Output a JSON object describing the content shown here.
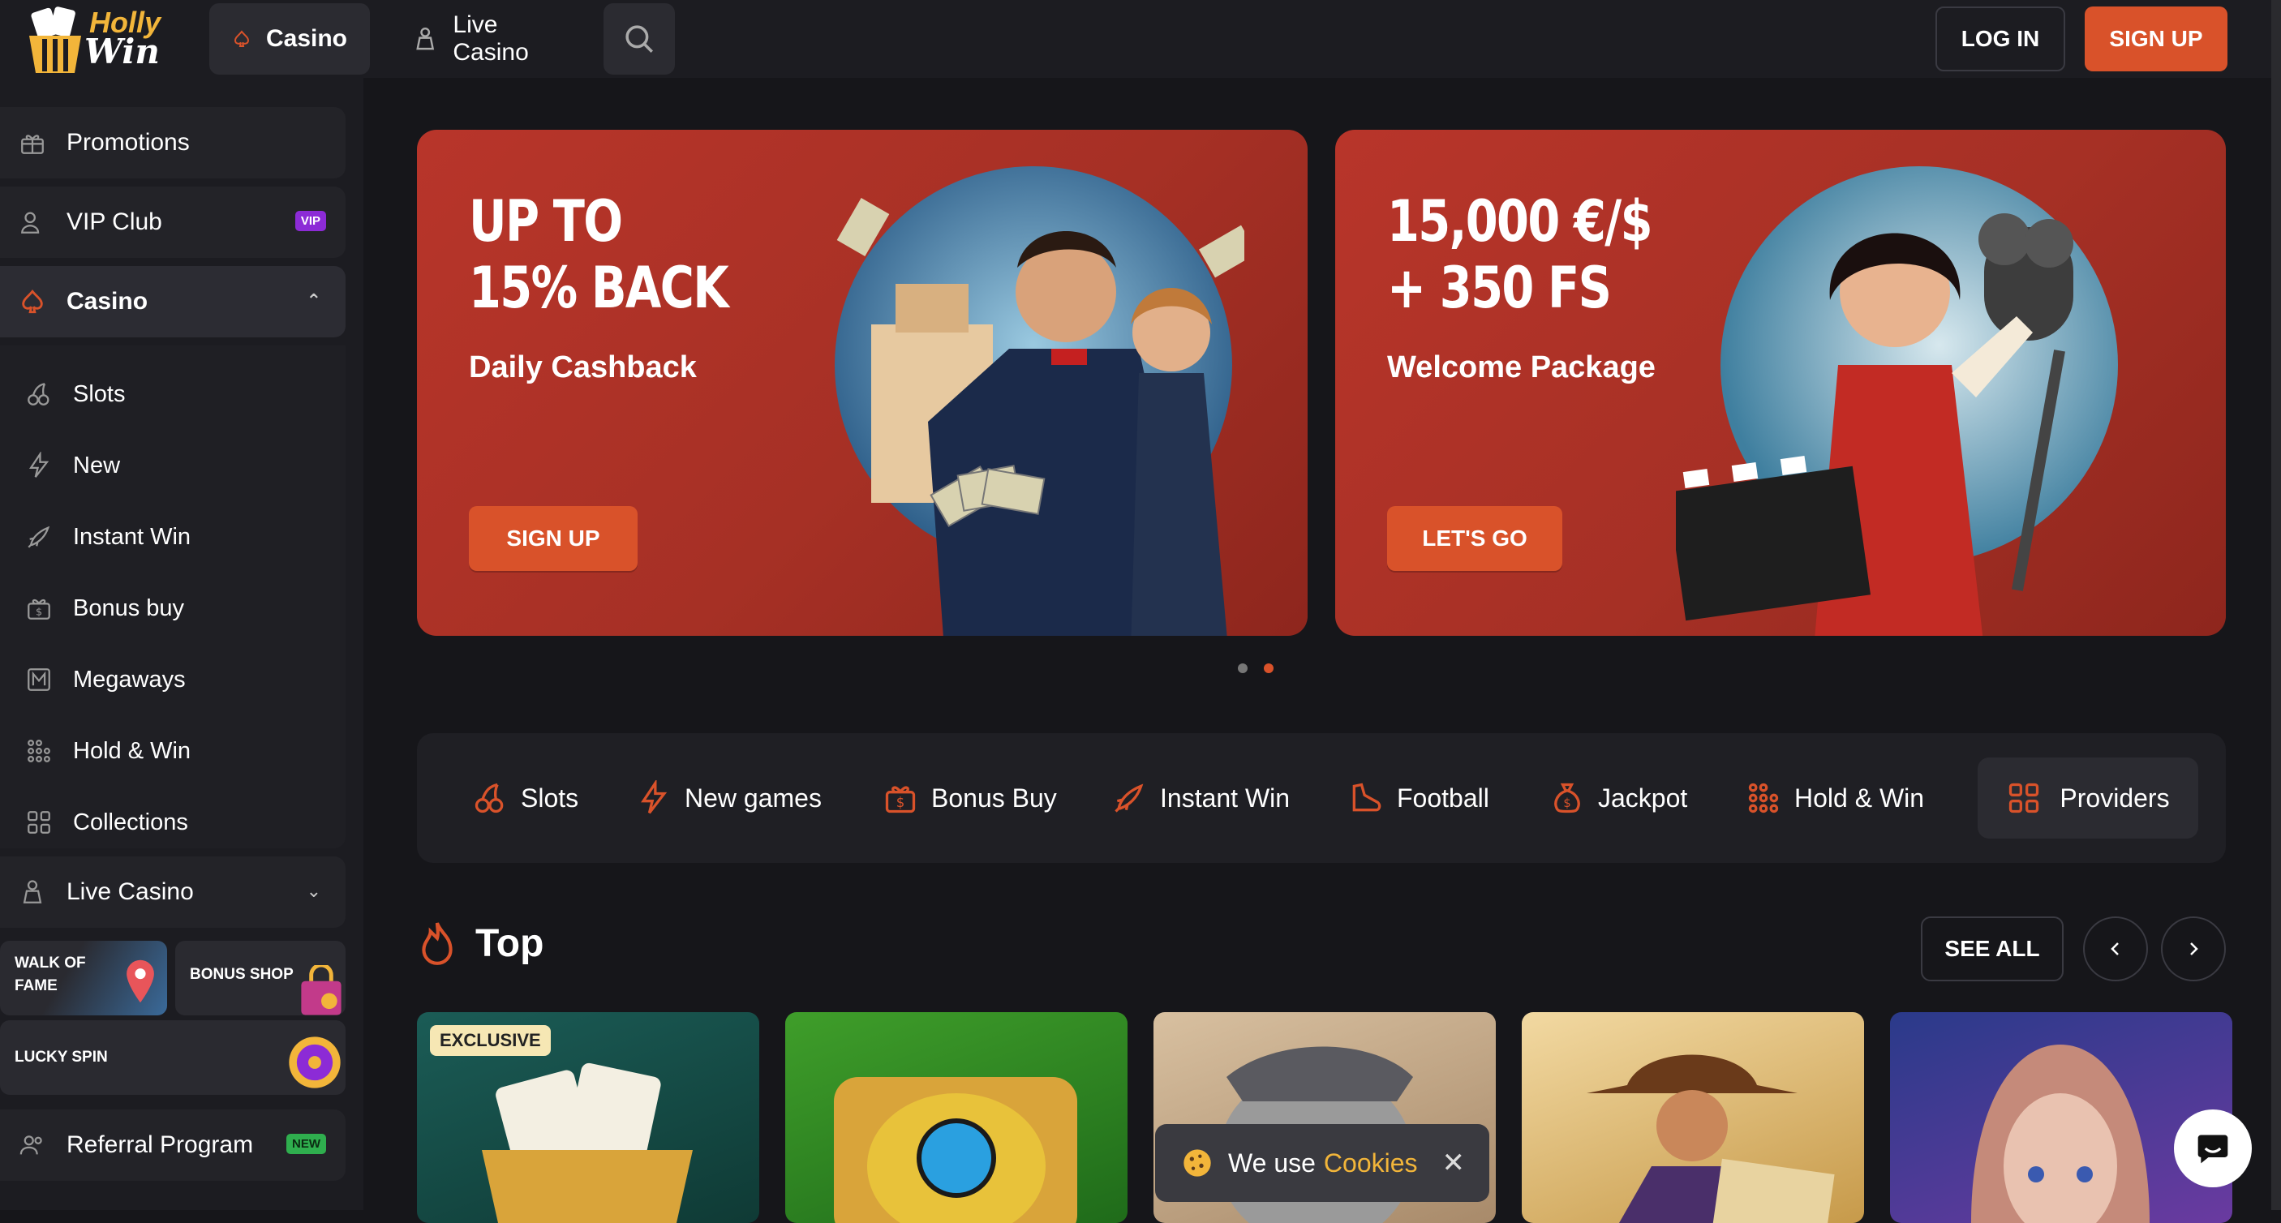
{
  "brand": {
    "name_line1": "Holly",
    "name_line2": "Win"
  },
  "header": {
    "nav": [
      {
        "label": "Casino"
      },
      {
        "label": "Live Casino"
      }
    ],
    "login_label": "LOG IN",
    "signup_label": "SIGN UP"
  },
  "sidebar": {
    "promotions": "Promotions",
    "vip": {
      "label": "VIP Club",
      "badge": "VIP"
    },
    "casino": "Casino",
    "casino_items": [
      "Slots",
      "New",
      "Instant Win",
      "Bonus buy",
      "Megaways",
      "Hold & Win",
      "Collections"
    ],
    "live_casino": "Live Casino",
    "tiles": {
      "walk_of_fame_1": "WALK OF",
      "walk_of_fame_2": "FAME",
      "bonus_shop": "BONUS SHOP",
      "lucky_spin": "LUCKY SPIN"
    },
    "referral": {
      "label": "Referral Program",
      "badge": "NEW"
    }
  },
  "banners": [
    {
      "line1": "UP TO",
      "line2": "15% BACK",
      "subtitle": "Daily Cashback",
      "cta": "SIGN UP"
    },
    {
      "line1": "15,000 €/$",
      "line2": "+ 350 FS",
      "subtitle": "Welcome Package",
      "cta": "LET'S GO"
    }
  ],
  "carousel": {
    "active_index": 1,
    "count": 2
  },
  "categories": [
    "Slots",
    "New games",
    "Bonus Buy",
    "Instant Win",
    "Football",
    "Jackpot",
    "Hold & Win",
    "Providers"
  ],
  "top": {
    "title": "Top",
    "see_all": "SEE ALL"
  },
  "games": [
    {
      "badge": "EXCLUSIVE"
    }
  ],
  "cookie": {
    "text": "We use",
    "link": "Cookies"
  },
  "colors": {
    "accent": "#d9522a",
    "gold": "#f2b53a",
    "bg": "#16161a",
    "panel": "#1c1c21"
  }
}
